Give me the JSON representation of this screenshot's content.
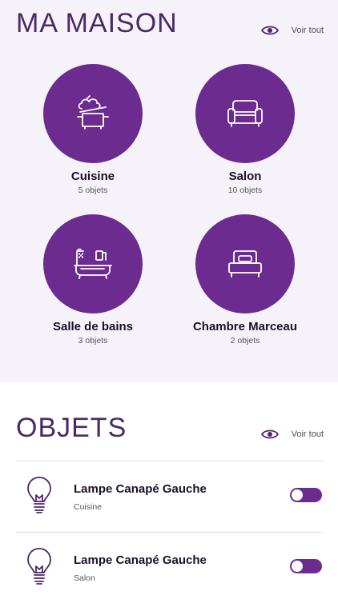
{
  "home": {
    "title": "MA MAISON",
    "see_all": "Voir tout"
  },
  "rooms": [
    {
      "name": "Cuisine",
      "count": "5 objets",
      "icon": "cooking-pot-icon"
    },
    {
      "name": "Salon",
      "count": "10 objets",
      "icon": "armchair-icon"
    },
    {
      "name": "Salle de bains",
      "count": "3 objets",
      "icon": "bathtub-icon"
    },
    {
      "name": "Chambre Marceau",
      "count": "2 objets",
      "icon": "bed-icon"
    }
  ],
  "objects_section": {
    "title": "OBJETS",
    "see_all": "Voir tout"
  },
  "objects": [
    {
      "name": "Lampe Canapé Gauche",
      "room": "Cuisine",
      "on": true,
      "icon": "light-bulb-icon"
    },
    {
      "name": "Lampe Canapé Gauche",
      "room": "Salon",
      "on": true,
      "icon": "light-bulb-icon"
    }
  ],
  "colors": {
    "accent": "#6c2c8f",
    "title": "#4b2968",
    "top_background": "#f5f3f9"
  }
}
